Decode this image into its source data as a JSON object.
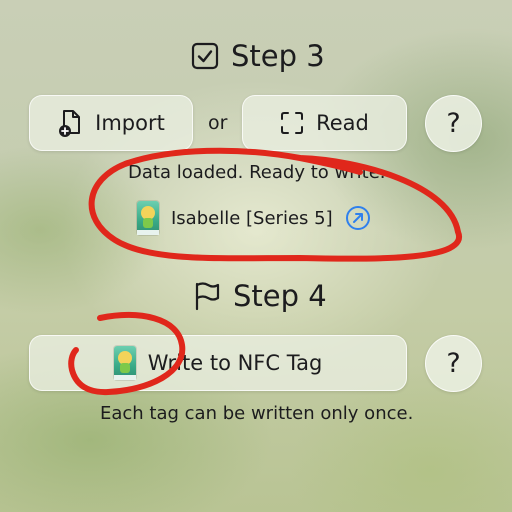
{
  "step3": {
    "title": "Step 3",
    "import_label": "Import",
    "or_label": "or",
    "read_label": "Read",
    "help_label": "?",
    "status_text": "Data loaded. Ready to write.",
    "amiibo_name": "Isabelle [Series 5]"
  },
  "step4": {
    "title": "Step 4",
    "write_label": "Write to NFC Tag",
    "help_label": "?",
    "note_text": "Each tag can be written only once."
  },
  "colors": {
    "link_blue": "#2f80ed",
    "annotation_red": "#e0271b"
  },
  "icons": [
    "checkbox-icon",
    "document-add-icon",
    "scan-frame-icon",
    "external-link-icon",
    "flag-icon",
    "amiibo-card-icon"
  ]
}
